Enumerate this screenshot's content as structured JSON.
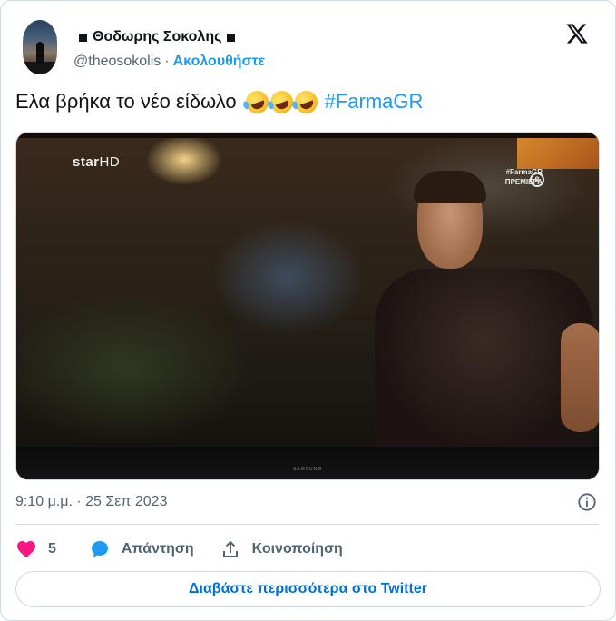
{
  "author": {
    "name": "Θοδωρης Σοκολης",
    "handle": "@theosokolis",
    "separator": "·",
    "follow_label": "Ακολουθήστε"
  },
  "platform_logo": "x-logo-icon",
  "tweet": {
    "text": "Ελα βρήκα το νέο είδωλο",
    "emojis": [
      "rolling-on-floor-laughing",
      "rolling-on-floor-laughing",
      "rolling-on-floor-laughing"
    ],
    "hashtag": "#FarmaGR"
  },
  "media": {
    "channel_logo": "star",
    "channel_logo_suffix": "HD",
    "show_tag_line1": "#FarmaGR",
    "show_tag_line2": "ΠΡΕΜΙΕΡΑ",
    "rating": "8",
    "tv_brand": "SAMSUNG"
  },
  "timestamp": "9:10 μ.μ. · 25 Σεπ 2023",
  "actions": {
    "like_count": "5",
    "reply_label": "Απάντηση",
    "share_label": "Κοινοποίηση"
  },
  "read_more_label": "Διαβάστε περισσότερα στο Twitter",
  "colors": {
    "accent": "#1d9bf0",
    "link_button": "#006fd6",
    "like": "#f91880",
    "muted": "#536471",
    "border": "#cfd9de"
  }
}
